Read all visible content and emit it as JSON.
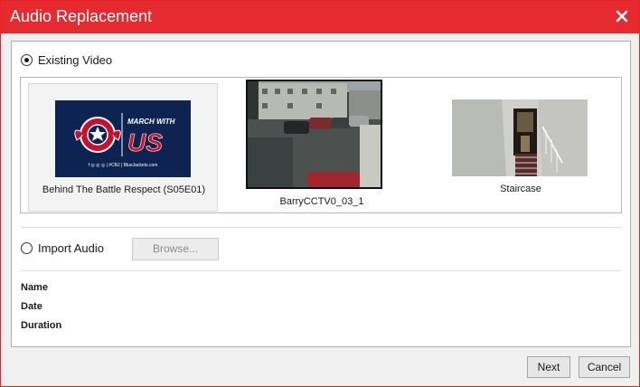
{
  "window": {
    "title": "Audio Replacement",
    "accent_color": "#e52b2f"
  },
  "source": {
    "existing_video_label": "Existing Video",
    "existing_video_selected": true,
    "import_audio_label": "Import Audio",
    "import_audio_selected": false,
    "browse_label": "Browse..."
  },
  "videos": [
    {
      "label": "Behind The Battle Respect (S05E01)",
      "thumbnail": "columbus-blue-jackets-march-with-us-banner",
      "thumbnail_text": {
        "headline_top": "MARCH WITH",
        "headline_main": "US",
        "footer": "f ◎ ◎ ◎ | #CBJ | BlueJackets.com"
      },
      "selected": true
    },
    {
      "label": "BarryCCTV0_03_1",
      "thumbnail": "cctv-parking-lot",
      "selected": false
    },
    {
      "label": "Staircase",
      "thumbnail": "staircase-hallway",
      "selected": false
    }
  ],
  "details": {
    "name_label": "Name",
    "date_label": "Date",
    "duration_label": "Duration"
  },
  "footer": {
    "next_label": "Next",
    "cancel_label": "Cancel"
  }
}
